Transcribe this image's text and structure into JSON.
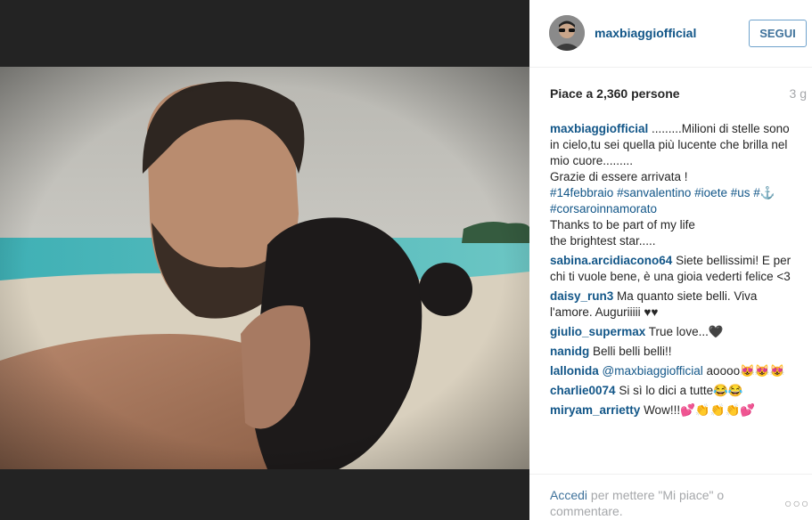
{
  "post": {
    "username": "maxbiaggiofficial",
    "follow_label": "SEGUI",
    "likes": "Piace a 2,360 persone",
    "time_ago": "3 g"
  },
  "comments": [
    {
      "user": "maxbiaggiofficial",
      "parts": [
        {
          "t": " .........Milioni di stelle sono in cielo,tu sei quella più lucente che brilla nel mio cuore.........",
          "br": true
        },
        {
          "t": "Grazie di essere arrivata !",
          "br": true
        },
        {
          "t": "#14febbraio",
          "tag": true
        },
        {
          "t": " "
        },
        {
          "t": "#sanvalentino",
          "tag": true
        },
        {
          "t": " "
        },
        {
          "t": "#ioete",
          "tag": true
        },
        {
          "t": " "
        },
        {
          "t": "#us",
          "tag": true
        },
        {
          "t": " "
        },
        {
          "t": "#⚓",
          "tag": true
        },
        {
          "t": " "
        },
        {
          "t": "#corsaroinnamorato",
          "tag": true,
          "br": true
        },
        {
          "t": "Thanks to be part of my life",
          "br": true
        },
        {
          "t": "the brightest star....."
        }
      ]
    },
    {
      "user": "sabina.arcidiacono64",
      "parts": [
        {
          "t": " Siete bellissimi! E per chi ti vuole bene, è una gioia vederti felice <3"
        }
      ]
    },
    {
      "user": "daisy_run3",
      "parts": [
        {
          "t": " Ma quanto siete belli. Viva l'amore. Auguriiiii ♥♥"
        }
      ]
    },
    {
      "user": "giulio_supermax",
      "parts": [
        {
          "t": " True love...🖤"
        }
      ]
    },
    {
      "user": "nanidg",
      "parts": [
        {
          "t": " Belli belli belli!!"
        }
      ]
    },
    {
      "user": "lallonida",
      "parts": [
        {
          "t": " "
        },
        {
          "t": "@maxbiaggiofficial",
          "tag": true
        },
        {
          "t": " aoooo😻😻😻"
        }
      ]
    },
    {
      "user": "charlie0074",
      "parts": [
        {
          "t": " Si sì lo dici a tutte😂😂"
        }
      ]
    },
    {
      "user": "miryam_arrietty",
      "parts": [
        {
          "t": " Wow!!!💕👏👏👏💕"
        }
      ]
    }
  ],
  "footer": {
    "login_link": "Accedi",
    "login_text": " per mettere \"Mi piace\" o commentare.",
    "more": "○○○"
  }
}
